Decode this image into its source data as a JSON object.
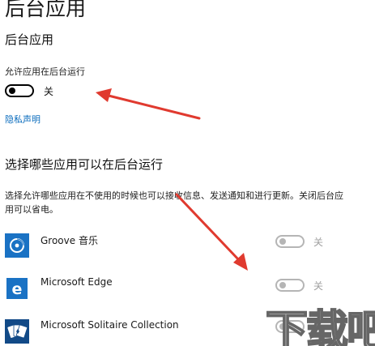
{
  "page_title": "后台应用",
  "section_header": "后台应用",
  "allow_background": {
    "label": "允许应用在后台运行",
    "state": "关"
  },
  "privacy_link": "隐私声明",
  "choose_heading": "选择哪些应用可以在后台运行",
  "description": "选择允许哪些应用在不使用的时候也可以接收信息、发送通知和进行更新。关闭后台应用可以省电。",
  "apps": [
    {
      "name": "Groove 音乐",
      "state": "关",
      "icon": "groove-music-icon"
    },
    {
      "name": "Microsoft Edge",
      "state": "关",
      "icon": "microsoft-edge-icon"
    },
    {
      "name": "Microsoft Solitaire Collection",
      "state": "关",
      "icon": "solitaire-cards-icon"
    }
  ],
  "watermark": "下载吧",
  "colors": {
    "link": "#0b6cbd",
    "arrow": "#e03a2f",
    "groove_tile": "#1a72c4",
    "solitaire_tile": "#124a87"
  }
}
